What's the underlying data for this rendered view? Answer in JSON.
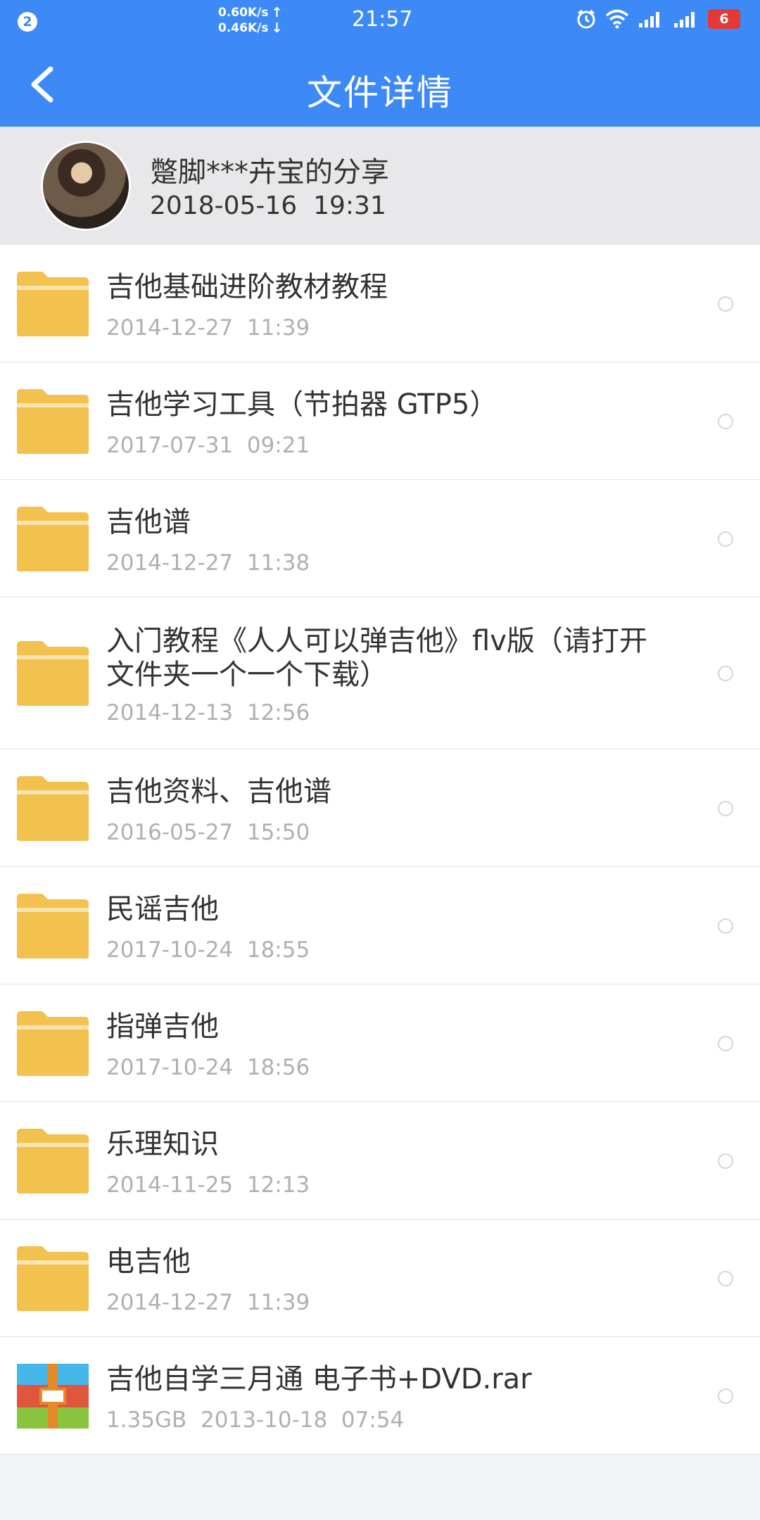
{
  "status_bar": {
    "notification_count": "2",
    "upload_speed": "0.60K/s",
    "download_speed": "0.46K/s",
    "time": "21:57",
    "battery": "6",
    "icons": [
      "alarm-icon",
      "wifi-icon",
      "signal-icon",
      "signal-2-icon"
    ]
  },
  "app_bar": {
    "title": "文件详情",
    "back_icon": "chevron-left-icon"
  },
  "share": {
    "owner": "蹩脚***卉宝的分享",
    "date": "2018-05-16  19:31"
  },
  "files": [
    {
      "name": "吉他基础进阶教材教程",
      "meta": "2014-12-27  11:39",
      "type": "folder"
    },
    {
      "name": "吉他学习工具（节拍器 GTP5）",
      "meta": "2017-07-31  09:21",
      "type": "folder"
    },
    {
      "name": "吉他谱",
      "meta": "2014-12-27  11:38",
      "type": "folder"
    },
    {
      "name": "入门教程《人人可以弹吉他》flv版（请打开文件夹一个一个下载）",
      "meta": "2014-12-13  12:56",
      "type": "folder"
    },
    {
      "name": "吉他资料、吉他谱",
      "meta": "2016-05-27  15:50",
      "type": "folder"
    },
    {
      "name": "民谣吉他",
      "meta": "2017-10-24  18:55",
      "type": "folder"
    },
    {
      "name": "指弹吉他",
      "meta": "2017-10-24  18:56",
      "type": "folder"
    },
    {
      "name": "乐理知识",
      "meta": "2014-11-25  12:13",
      "type": "folder"
    },
    {
      "name": "电吉他",
      "meta": "2014-12-27  11:39",
      "type": "folder"
    },
    {
      "name": "吉他自学三月通 电子书+DVD.rar",
      "meta": "1.35GB  2013-10-18  07:54",
      "type": "rar"
    }
  ],
  "colors": {
    "accent": "#3d8af7",
    "folder": "#f2c14e",
    "meta_text": "#b0b0b0"
  }
}
